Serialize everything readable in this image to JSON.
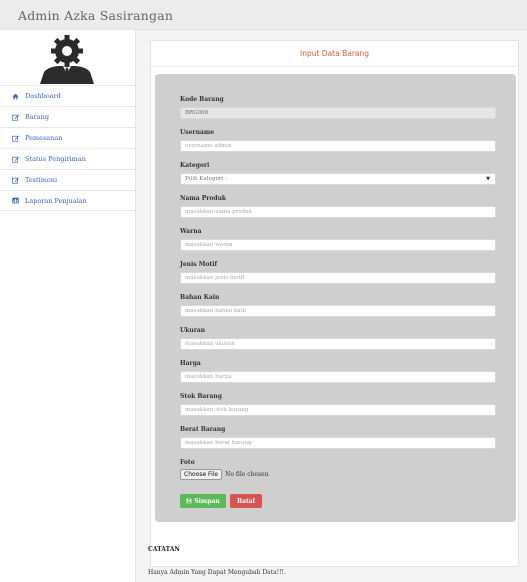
{
  "app": {
    "brand": "Admin Azka Sasirangan"
  },
  "sidebar": {
    "items": [
      {
        "label": "Dashboard",
        "icon": "home-icon"
      },
      {
        "label": "Barang",
        "icon": "edit-icon"
      },
      {
        "label": "Pemesanan",
        "icon": "edit-icon"
      },
      {
        "label": "Status Pengiriman",
        "icon": "edit-icon"
      },
      {
        "label": "Testimoni",
        "icon": "edit-icon"
      },
      {
        "label": "Laporan Penjualan",
        "icon": "chart-icon"
      }
    ]
  },
  "form": {
    "title": "Input Data Barang",
    "kode_barang": {
      "label": "Kode Barang",
      "value": "BRG008"
    },
    "username": {
      "label": "Username",
      "placeholder": "username admin"
    },
    "kategori": {
      "label": "Kategori",
      "selected": "Pilih Kategori :"
    },
    "nama_produk": {
      "label": "Nama Produk",
      "placeholder": "masukkan nama produk"
    },
    "warna": {
      "label": "Warna",
      "placeholder": "masukkan warna"
    },
    "jenis_motif": {
      "label": "Jenis Motif",
      "placeholder": "masukkan jenis motif"
    },
    "bahan_kain": {
      "label": "Bahan Kain",
      "placeholder": "masukkan bahan kain"
    },
    "ukuran": {
      "label": "Ukuran",
      "placeholder": "masukkan ukuran"
    },
    "harga": {
      "label": "Harga",
      "placeholder": "masukkan harga"
    },
    "stok_barang": {
      "label": "Stok Barang",
      "placeholder": "masukkan stok barang"
    },
    "berat_barang": {
      "label": "Berat Barang",
      "placeholder": "masukkan berat barang"
    },
    "foto": {
      "label": "Foto",
      "button": "Choose File",
      "status": "No file chosen"
    },
    "save_label": "Simpan",
    "cancel_label": "Batal"
  },
  "notes": {
    "title": "CATATAN",
    "text": "Hanya Admin Yang Dapat Mengubah Data!!!."
  },
  "colors": {
    "accent_title": "#e55a2b",
    "save": "#5cb85c",
    "cancel": "#d9534f",
    "link": "#3a5fc9"
  }
}
